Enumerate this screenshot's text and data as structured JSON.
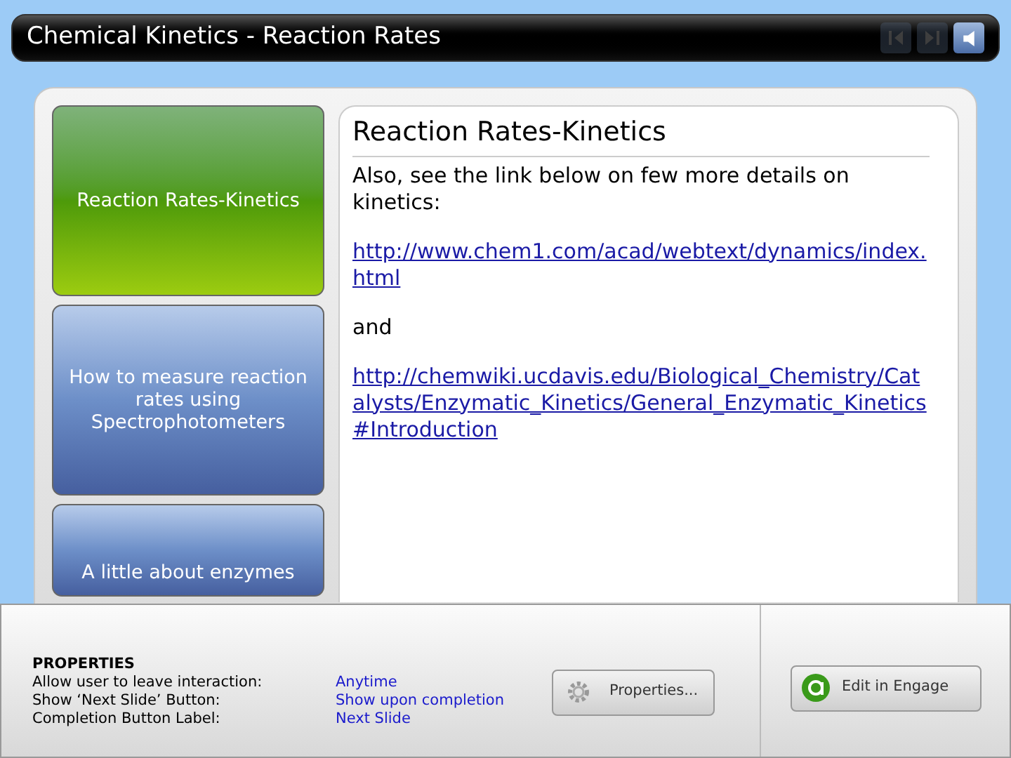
{
  "window": {
    "title": "Chemical Kinetics - Reaction Rates"
  },
  "nav_buttons": [
    {
      "kind": "previous",
      "disabled": true
    },
    {
      "kind": "next",
      "disabled": true
    },
    {
      "kind": "audio",
      "disabled": false
    }
  ],
  "tabs": [
    {
      "label": "Reaction Rates-Kinetics",
      "selected": true
    },
    {
      "label": "How to measure reaction rates using Spectrophotometers",
      "selected": false
    },
    {
      "label": "A little about enzymes",
      "selected": false
    }
  ],
  "content": {
    "heading": "Reaction Rates-Kinetics",
    "blocks": [
      {
        "kind": "text",
        "text": "Also, see the link below on few more details on kinetics:"
      },
      {
        "kind": "link",
        "text": "http://www.chem1.com/acad/webtext/dynamics/index.html"
      },
      {
        "kind": "text",
        "text": "and"
      },
      {
        "kind": "link",
        "text": "http://chemwiki.ucdavis.edu/Biological_Chemistry/Catalysts/Enzymatic_Kinetics/General_Enzymatic_Kinetics#Introduction"
      }
    ]
  },
  "properties": {
    "heading": "PROPERTIES",
    "rows": [
      {
        "label": "Allow user to leave interaction:",
        "value": "Anytime"
      },
      {
        "label": "Show ‘Next Slide’ Button:",
        "value": "Show upon completion"
      },
      {
        "label": "Completion Button Label:",
        "value": "Next Slide"
      }
    ],
    "properties_button": "Properties...",
    "engage_button": "Edit in Engage"
  }
}
